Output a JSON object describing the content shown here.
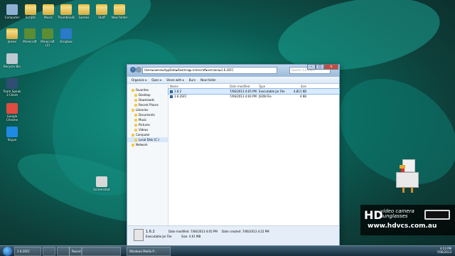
{
  "desktop": {
    "icons": [
      {
        "label": "Computer",
        "type": "computer"
      },
      {
        "label": "Scripts",
        "type": "folder"
      },
      {
        "label": "Music",
        "type": "folder"
      },
      {
        "label": "Thumbnails",
        "type": "folder"
      },
      {
        "label": "Games",
        "type": "folder"
      },
      {
        "label": "Stuff",
        "type": "folder"
      },
      {
        "label": "New folder",
        "type": "folder"
      },
      {
        "label": "James",
        "type": "folder"
      },
      {
        "label": "Minecraft",
        "type": "minecraft"
      },
      {
        "label": "Minecraft (2)",
        "type": "minecraft"
      },
      {
        "label": "Dropbox",
        "type": "dropbox"
      },
      {
        "label": "Recycle Bin",
        "type": "recycle"
      },
      {
        "label": "Team Speak 3 Client",
        "type": "teamspeak"
      },
      {
        "label": "Google Chrome",
        "type": "chrome"
      },
      {
        "label": "Skype",
        "type": "skype"
      },
      {
        "label": "Screenshot",
        "type": "file"
      }
    ]
  },
  "window": {
    "path": [
      "Users",
      "owner",
      "AppData",
      "Roaming",
      ".minecraft",
      "versions",
      "1.6.2SFC"
    ],
    "search_placeholder": "Search 1.6.2SFC",
    "toolbar": [
      "Organize ▾",
      "Open ▾",
      "Share with ▾",
      "Burn",
      "New folder"
    ],
    "nav": [
      {
        "label": "Favorites",
        "level": 0,
        "icon": "star"
      },
      {
        "label": "Desktop",
        "level": 1,
        "icon": "desktop"
      },
      {
        "label": "Downloads",
        "level": 1,
        "icon": "downloads"
      },
      {
        "label": "Recent Places",
        "level": 1,
        "icon": "recent"
      },
      {
        "label": "Libraries",
        "level": 0,
        "icon": "library"
      },
      {
        "label": "Documents",
        "level": 1,
        "icon": "documents"
      },
      {
        "label": "Music",
        "level": 1,
        "icon": "music"
      },
      {
        "label": "Pictures",
        "level": 1,
        "icon": "pictures"
      },
      {
        "label": "Videos",
        "level": 1,
        "icon": "videos"
      },
      {
        "label": "Computer",
        "level": 0,
        "icon": "computer"
      },
      {
        "label": "Local Disk (C:)",
        "level": 1,
        "icon": "drive",
        "selected": true
      },
      {
        "label": "Network",
        "level": 0,
        "icon": "network"
      }
    ],
    "columns": {
      "name": "Name",
      "date": "Date modified",
      "type": "Type",
      "size": "Size"
    },
    "files": [
      {
        "name": "1.6.2",
        "date": "7/06/2013 4:05 PM",
        "type": "Executable Jar File",
        "size": "4,811 KB",
        "selected": true
      },
      {
        "name": "1.6.2SFC",
        "date": "7/06/2013 4:04 PM",
        "type": "JSON File",
        "size": "4 KB",
        "selected": false
      }
    ],
    "details": {
      "name": "1.6.2",
      "type": "Executable Jar File",
      "modified_label": "Date modified:",
      "modified": "7/06/2013 4:05 PM",
      "size_label": "Size:",
      "size": "4.61 MB",
      "created_label": "Date created:",
      "created": "7/06/2013 4:22 PM"
    }
  },
  "taskbar": {
    "items": [
      "1.6.2SFC",
      "",
      "",
      "Recording...",
      "",
      "Windows Media P..."
    ],
    "time": "4:23 PM",
    "date": "7/06/2013"
  },
  "logo": {
    "prefix": "HD",
    "title": "video camera sunglasses",
    "url": "www.hdvcs.com.au"
  },
  "colors": {
    "accent": "#4d8bd1",
    "selected": "#d9ebff",
    "taskbar": "#24394a"
  }
}
